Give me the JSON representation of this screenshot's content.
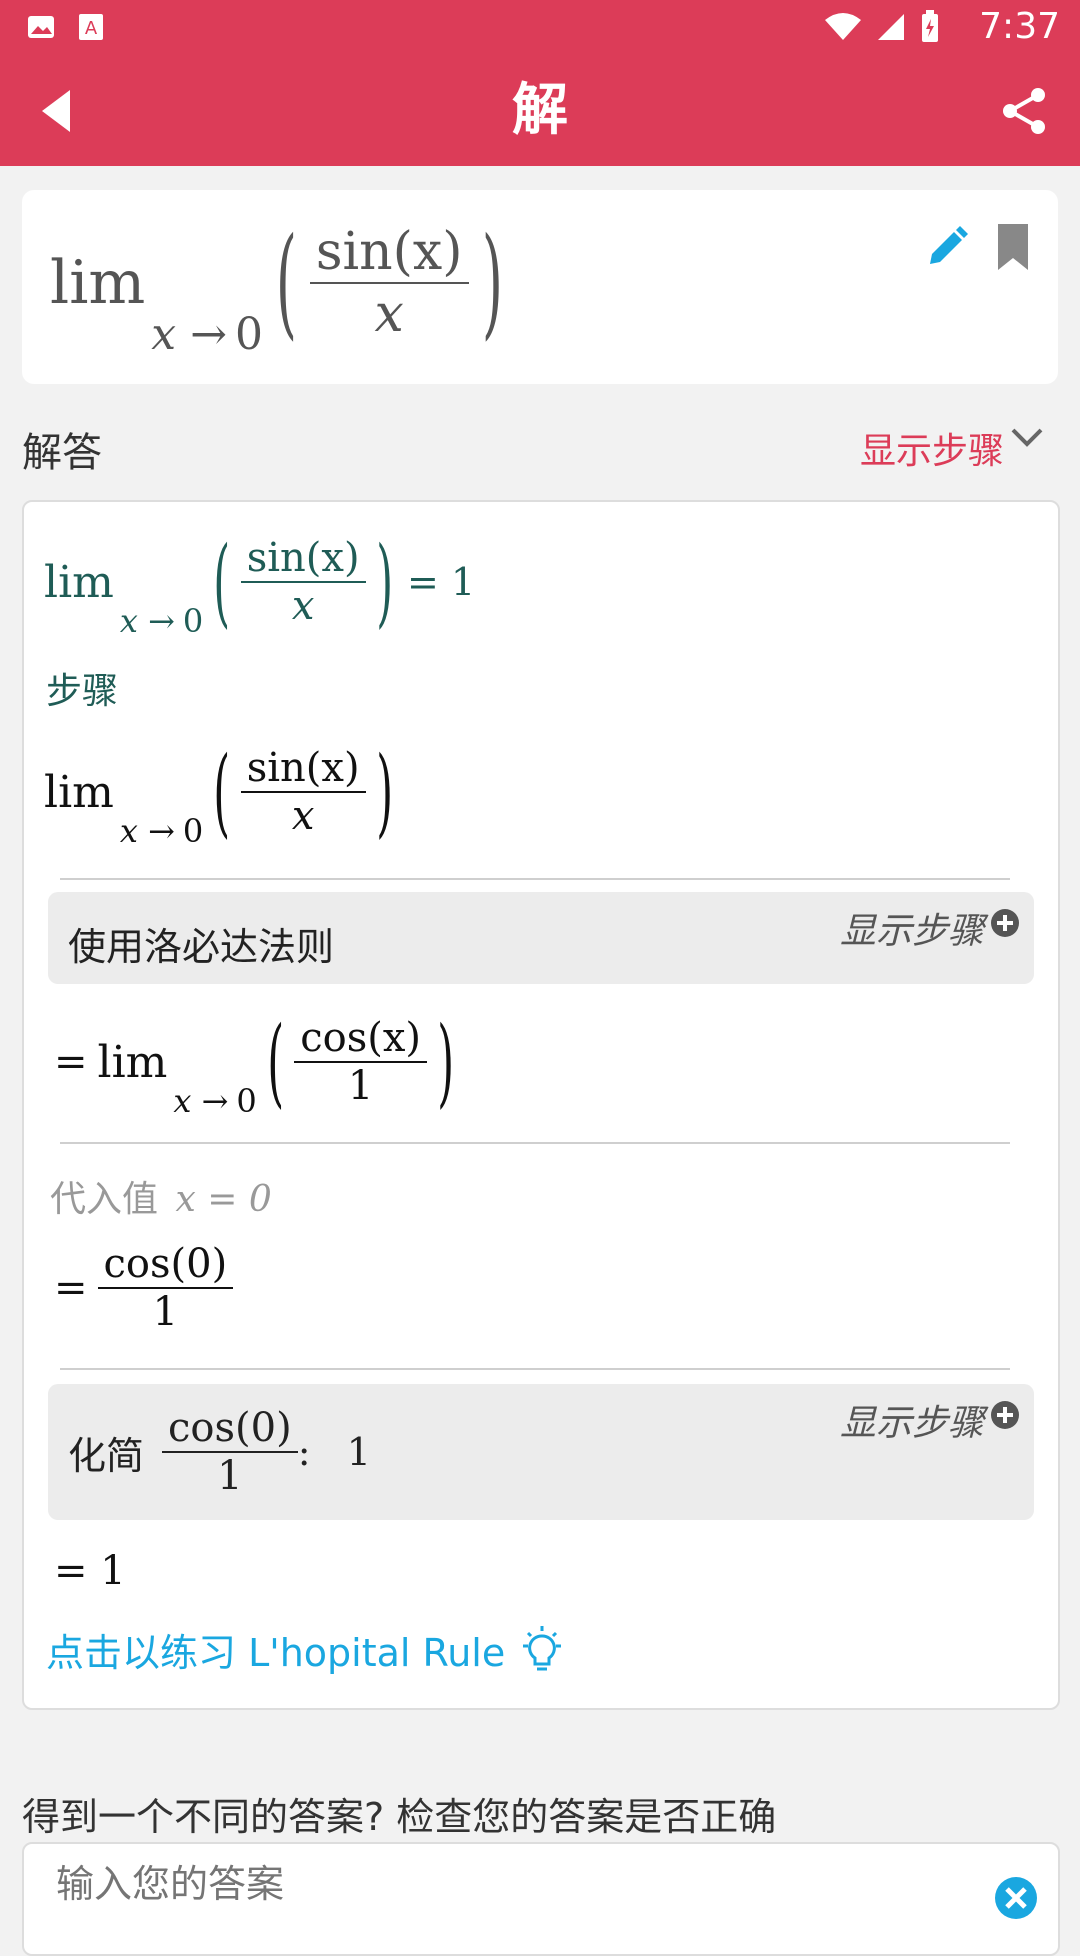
{
  "status": {
    "time": "7:37"
  },
  "appbar": {
    "title": "解"
  },
  "input": {
    "lim": "lim",
    "sub_var": "x",
    "sub_arrow": "→",
    "sub_val": "0",
    "num": "sin(x)",
    "den": "x"
  },
  "solution_header": {
    "label": "解答",
    "show_steps": "显示步骤"
  },
  "solution": {
    "result_eq": "= 1",
    "steps_label": "步骤",
    "step1_title": "使用洛必达法则",
    "step1_show": "显示步骤",
    "step2_num": "cos(x)",
    "step2_den": "1",
    "sub_label": "代入值",
    "sub_expr": "x = 0",
    "step3_num": "cos(0)",
    "step3_den": "1",
    "step4_title": "化简",
    "step4_show": "显示步骤",
    "step4_result": ":   1",
    "final": "= 1",
    "practice": "点击以练习 L'hopital Rule"
  },
  "answer": {
    "label": "得到一个不同的答案? 检查您的答案是否正确",
    "placeholder": "输入您的答案"
  },
  "colors": {
    "accent": "#dc3c58",
    "link": "#1aa7e0",
    "math_green": "#1f5c56"
  }
}
